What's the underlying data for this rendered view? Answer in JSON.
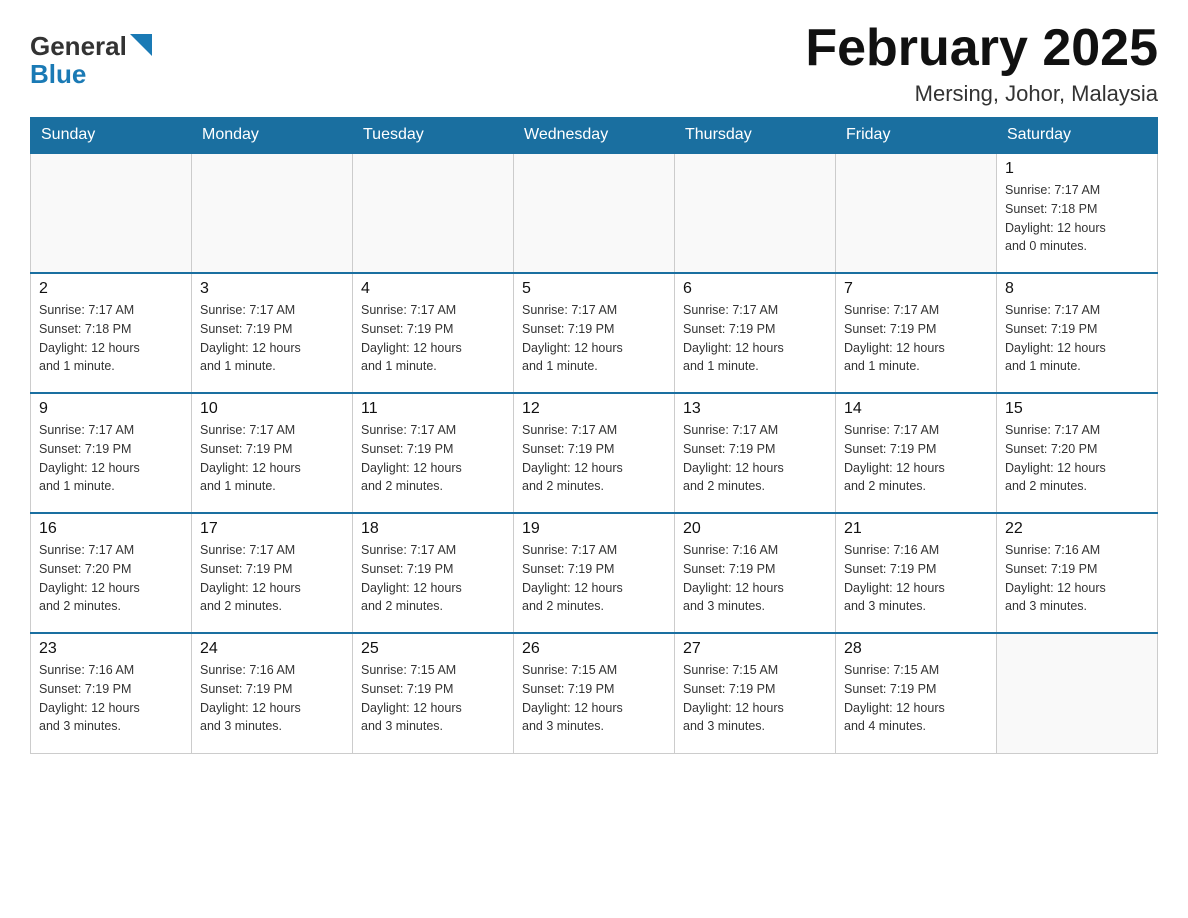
{
  "header": {
    "title": "February 2025",
    "location": "Mersing, Johor, Malaysia"
  },
  "logo": {
    "general": "General",
    "blue": "Blue"
  },
  "days_of_week": [
    "Sunday",
    "Monday",
    "Tuesday",
    "Wednesday",
    "Thursday",
    "Friday",
    "Saturday"
  ],
  "weeks": [
    {
      "days": [
        {
          "num": "",
          "info": ""
        },
        {
          "num": "",
          "info": ""
        },
        {
          "num": "",
          "info": ""
        },
        {
          "num": "",
          "info": ""
        },
        {
          "num": "",
          "info": ""
        },
        {
          "num": "",
          "info": ""
        },
        {
          "num": "1",
          "info": "Sunrise: 7:17 AM\nSunset: 7:18 PM\nDaylight: 12 hours\nand 0 minutes."
        }
      ]
    },
    {
      "days": [
        {
          "num": "2",
          "info": "Sunrise: 7:17 AM\nSunset: 7:18 PM\nDaylight: 12 hours\nand 1 minute."
        },
        {
          "num": "3",
          "info": "Sunrise: 7:17 AM\nSunset: 7:19 PM\nDaylight: 12 hours\nand 1 minute."
        },
        {
          "num": "4",
          "info": "Sunrise: 7:17 AM\nSunset: 7:19 PM\nDaylight: 12 hours\nand 1 minute."
        },
        {
          "num": "5",
          "info": "Sunrise: 7:17 AM\nSunset: 7:19 PM\nDaylight: 12 hours\nand 1 minute."
        },
        {
          "num": "6",
          "info": "Sunrise: 7:17 AM\nSunset: 7:19 PM\nDaylight: 12 hours\nand 1 minute."
        },
        {
          "num": "7",
          "info": "Sunrise: 7:17 AM\nSunset: 7:19 PM\nDaylight: 12 hours\nand 1 minute."
        },
        {
          "num": "8",
          "info": "Sunrise: 7:17 AM\nSunset: 7:19 PM\nDaylight: 12 hours\nand 1 minute."
        }
      ]
    },
    {
      "days": [
        {
          "num": "9",
          "info": "Sunrise: 7:17 AM\nSunset: 7:19 PM\nDaylight: 12 hours\nand 1 minute."
        },
        {
          "num": "10",
          "info": "Sunrise: 7:17 AM\nSunset: 7:19 PM\nDaylight: 12 hours\nand 1 minute."
        },
        {
          "num": "11",
          "info": "Sunrise: 7:17 AM\nSunset: 7:19 PM\nDaylight: 12 hours\nand 2 minutes."
        },
        {
          "num": "12",
          "info": "Sunrise: 7:17 AM\nSunset: 7:19 PM\nDaylight: 12 hours\nand 2 minutes."
        },
        {
          "num": "13",
          "info": "Sunrise: 7:17 AM\nSunset: 7:19 PM\nDaylight: 12 hours\nand 2 minutes."
        },
        {
          "num": "14",
          "info": "Sunrise: 7:17 AM\nSunset: 7:19 PM\nDaylight: 12 hours\nand 2 minutes."
        },
        {
          "num": "15",
          "info": "Sunrise: 7:17 AM\nSunset: 7:20 PM\nDaylight: 12 hours\nand 2 minutes."
        }
      ]
    },
    {
      "days": [
        {
          "num": "16",
          "info": "Sunrise: 7:17 AM\nSunset: 7:20 PM\nDaylight: 12 hours\nand 2 minutes."
        },
        {
          "num": "17",
          "info": "Sunrise: 7:17 AM\nSunset: 7:19 PM\nDaylight: 12 hours\nand 2 minutes."
        },
        {
          "num": "18",
          "info": "Sunrise: 7:17 AM\nSunset: 7:19 PM\nDaylight: 12 hours\nand 2 minutes."
        },
        {
          "num": "19",
          "info": "Sunrise: 7:17 AM\nSunset: 7:19 PM\nDaylight: 12 hours\nand 2 minutes."
        },
        {
          "num": "20",
          "info": "Sunrise: 7:16 AM\nSunset: 7:19 PM\nDaylight: 12 hours\nand 3 minutes."
        },
        {
          "num": "21",
          "info": "Sunrise: 7:16 AM\nSunset: 7:19 PM\nDaylight: 12 hours\nand 3 minutes."
        },
        {
          "num": "22",
          "info": "Sunrise: 7:16 AM\nSunset: 7:19 PM\nDaylight: 12 hours\nand 3 minutes."
        }
      ]
    },
    {
      "days": [
        {
          "num": "23",
          "info": "Sunrise: 7:16 AM\nSunset: 7:19 PM\nDaylight: 12 hours\nand 3 minutes."
        },
        {
          "num": "24",
          "info": "Sunrise: 7:16 AM\nSunset: 7:19 PM\nDaylight: 12 hours\nand 3 minutes."
        },
        {
          "num": "25",
          "info": "Sunrise: 7:15 AM\nSunset: 7:19 PM\nDaylight: 12 hours\nand 3 minutes."
        },
        {
          "num": "26",
          "info": "Sunrise: 7:15 AM\nSunset: 7:19 PM\nDaylight: 12 hours\nand 3 minutes."
        },
        {
          "num": "27",
          "info": "Sunrise: 7:15 AM\nSunset: 7:19 PM\nDaylight: 12 hours\nand 3 minutes."
        },
        {
          "num": "28",
          "info": "Sunrise: 7:15 AM\nSunset: 7:19 PM\nDaylight: 12 hours\nand 4 minutes."
        },
        {
          "num": "",
          "info": ""
        }
      ]
    }
  ]
}
